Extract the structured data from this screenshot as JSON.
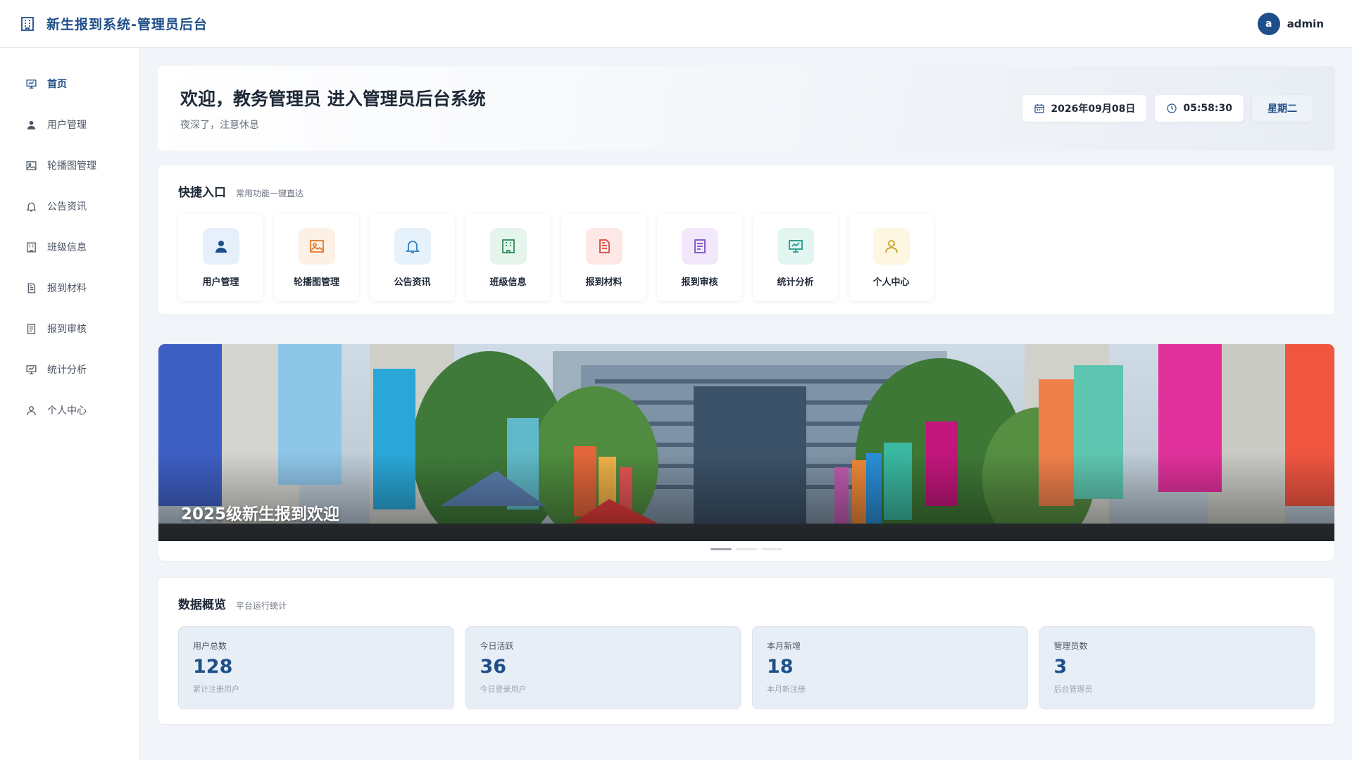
{
  "header": {
    "title": "新生报到系统-管理员后台",
    "avatar_letter": "a",
    "username": "admin"
  },
  "sidebar": {
    "items": [
      {
        "label": "首页",
        "icon": "presentation-icon",
        "active": true
      },
      {
        "label": "用户管理",
        "icon": "user-icon"
      },
      {
        "label": "轮播图管理",
        "icon": "image-icon"
      },
      {
        "label": "公告资讯",
        "icon": "bell-icon"
      },
      {
        "label": "班级信息",
        "icon": "building-icon"
      },
      {
        "label": "报到材料",
        "icon": "document-icon"
      },
      {
        "label": "报到审核",
        "icon": "checklist-icon"
      },
      {
        "label": "统计分析",
        "icon": "chart-board-icon"
      },
      {
        "label": "个人中心",
        "icon": "profile-icon"
      }
    ]
  },
  "welcome": {
    "title": "欢迎，教务管理员 进入管理员后台系统",
    "subtitle": "夜深了，注意休息",
    "date": "2026年09月08日",
    "time": "05:58:30",
    "weekday": "星期二"
  },
  "quick": {
    "title": "快捷入口",
    "subtitle": "常用功能一键直达",
    "items": [
      {
        "label": "用户管理",
        "icon": "user-icon",
        "color": "#1e4f8a",
        "bg": "#e6f0fb"
      },
      {
        "label": "轮播图管理",
        "icon": "image-icon",
        "color": "#e07a2f",
        "bg": "#fdf0e4"
      },
      {
        "label": "公告资讯",
        "icon": "bell-icon",
        "color": "#2f7fc1",
        "bg": "#e6f2fb"
      },
      {
        "label": "班级信息",
        "icon": "building-icon",
        "color": "#2e8b57",
        "bg": "#e5f5ec"
      },
      {
        "label": "报到材料",
        "icon": "document-icon",
        "color": "#d9463b",
        "bg": "#fde8e6"
      },
      {
        "label": "报到审核",
        "icon": "checklist-icon",
        "color": "#7b4fc0",
        "bg": "#f1e9fb"
      },
      {
        "label": "统计分析",
        "icon": "chart-board-icon",
        "color": "#1f9a86",
        "bg": "#e3f5f1"
      },
      {
        "label": "个人中心",
        "icon": "profile-icon",
        "color": "#c99a1e",
        "bg": "#fdf6e0"
      }
    ]
  },
  "banner": {
    "caption": "2025级新生报到欢迎"
  },
  "overview": {
    "title": "数据概览",
    "subtitle": "平台运行统计",
    "stats": [
      {
        "label": "用户总数",
        "value": "128",
        "desc": "累计注册用户"
      },
      {
        "label": "今日活跃",
        "value": "36",
        "desc": "今日登录用户"
      },
      {
        "label": "本月新增",
        "value": "18",
        "desc": "本月新注册"
      },
      {
        "label": "管理员数",
        "value": "3",
        "desc": "后台管理员"
      }
    ]
  },
  "colors": {
    "primary": "#1e4f8a",
    "background": "#f1f4f8"
  }
}
